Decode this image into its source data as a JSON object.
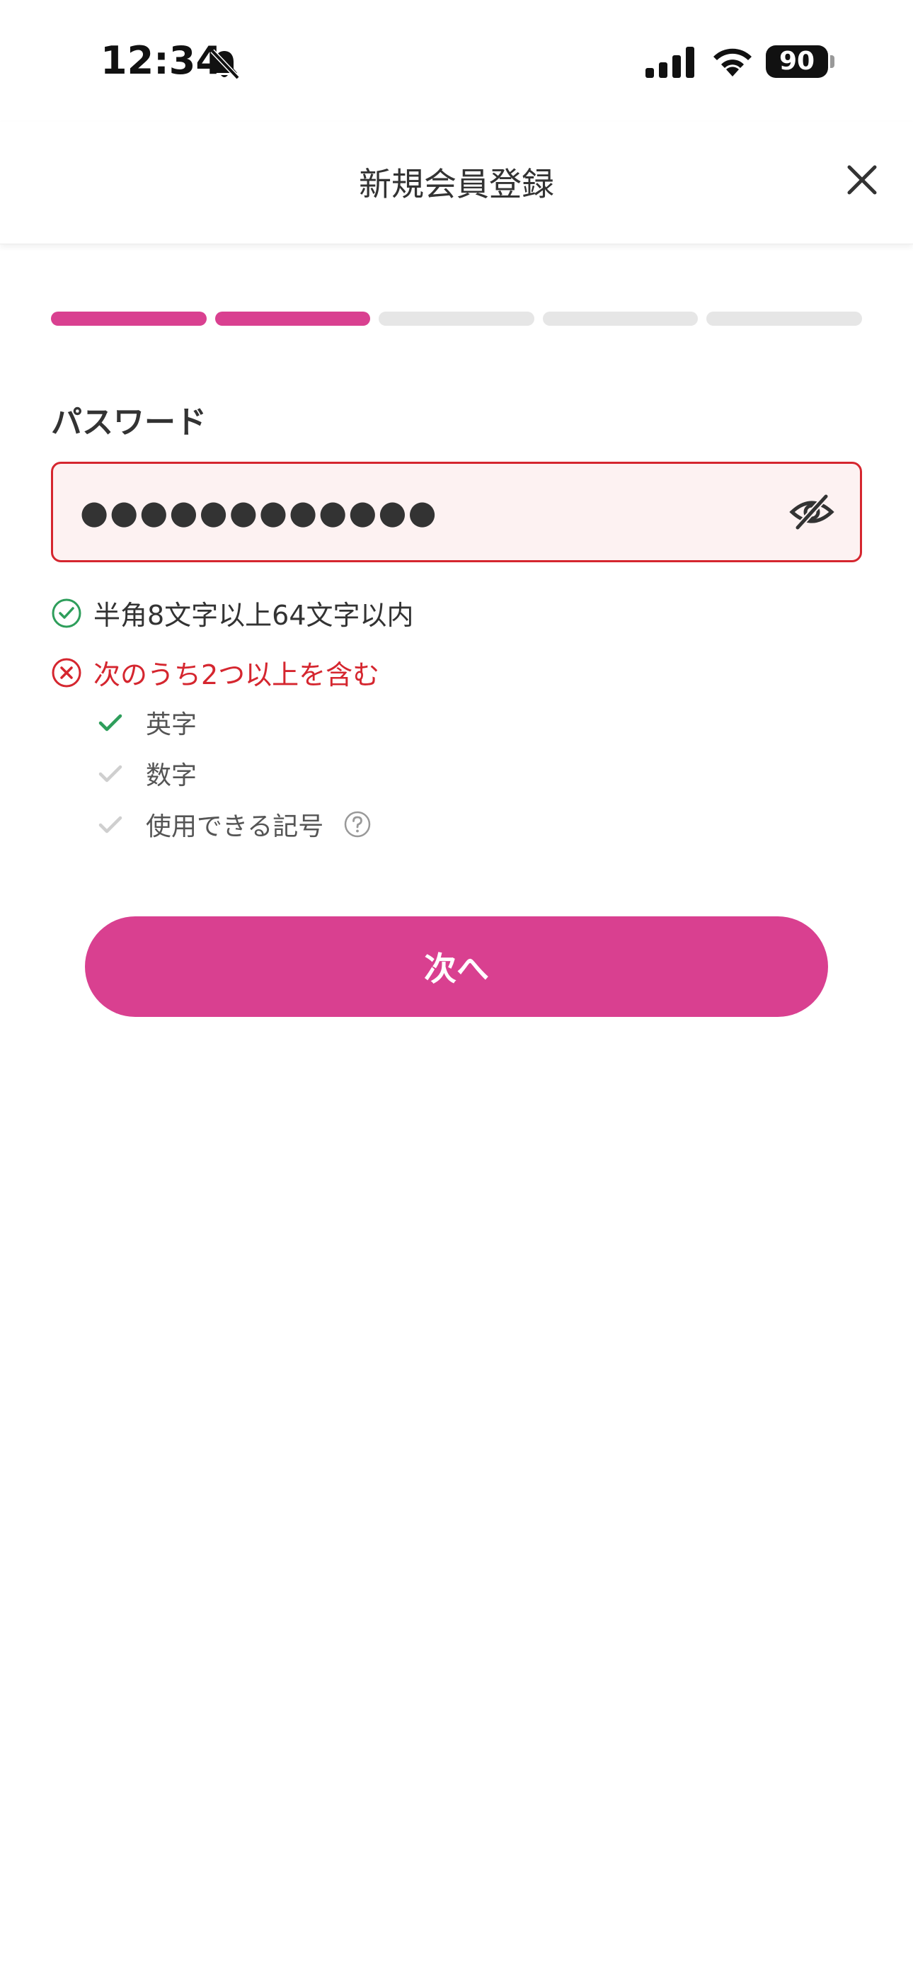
{
  "status_bar": {
    "time": "12:34",
    "battery_level": "90",
    "icons": [
      "bell-slash-icon",
      "cellular-signal-icon",
      "wifi-icon",
      "battery-icon"
    ]
  },
  "header": {
    "title": "新規会員登録",
    "close_icon": "close-icon"
  },
  "progress": {
    "total_steps": 5,
    "completed_steps": 2,
    "active_color": "#d94090",
    "inactive_color": "#e6e6e6"
  },
  "form": {
    "label": "パスワード",
    "password_masked": "●●●●●●●●●●●●",
    "error_color": "#d5262f",
    "toggle_icon": "eye-slash-icon",
    "rules": [
      {
        "text": "半角8文字以上64文字以内",
        "status": "ok",
        "icon": "check-circle-icon"
      },
      {
        "text": "次のうち2つ以上を含む",
        "status": "error",
        "icon": "x-circle-icon"
      }
    ],
    "subrules": [
      {
        "text": "英字",
        "met": true
      },
      {
        "text": "数字",
        "met": false
      },
      {
        "text": "使用できる記号",
        "met": false,
        "help_icon": "question-circle-icon"
      }
    ]
  },
  "next_button": {
    "label": "次へ",
    "color": "#d94090"
  }
}
